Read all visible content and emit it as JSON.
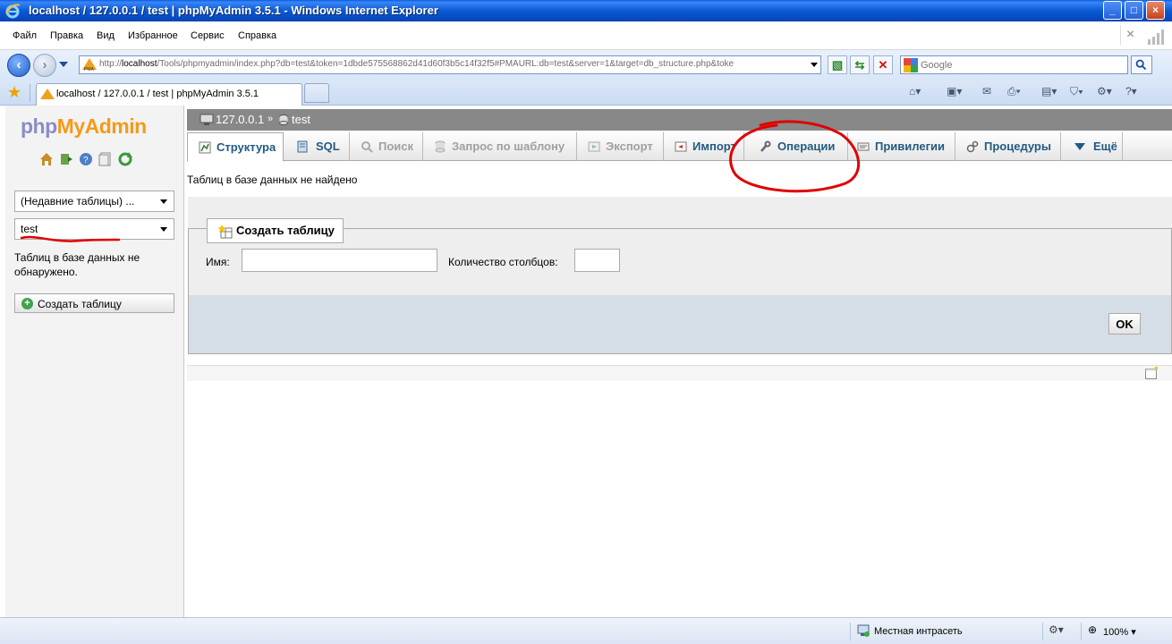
{
  "window": {
    "title": "localhost / 127.0.0.1 / test | phpMyAdmin 3.5.1 - Windows Internet Explorer",
    "controls": [
      "_",
      "□",
      "×"
    ]
  },
  "menubar": {
    "items": [
      "Файл",
      "Правка",
      "Вид",
      "Избранное",
      "Сервис",
      "Справка"
    ]
  },
  "address": {
    "prefix": "http://",
    "host": "localhost",
    "rest": "/Tools/phpmyadmin/index.php?db=test&token=1dbde575568862d41d60f3b5c14f32f5#PMAURL:db=test&server=1&target=db_structure.php&toke",
    "search_placeholder": "Google"
  },
  "browser_tab": {
    "label": "localhost / 127.0.0.1 / test | phpMyAdmin 3.5.1"
  },
  "left_panel": {
    "logo_php": "php",
    "logo_myadmin": "MyAdmin",
    "recent_tables": "(Недавние таблицы) ...",
    "db_select": "test",
    "no_tables": "Таблиц в базе данных не обнаружено.",
    "create_table": "Создать таблицу"
  },
  "breadcrumb": {
    "server": "127.0.0.1",
    "separator": "»",
    "database": "test"
  },
  "tabs": [
    {
      "label": "Структура",
      "state": "active"
    },
    {
      "label": "SQL",
      "state": "enabled"
    },
    {
      "label": "Поиск",
      "state": "disabled"
    },
    {
      "label": "Запрос по шаблону",
      "state": "disabled"
    },
    {
      "label": "Экспорт",
      "state": "disabled"
    },
    {
      "label": "Импорт",
      "state": "enabled"
    },
    {
      "label": "Операции",
      "state": "enabled"
    },
    {
      "label": "Привилегии",
      "state": "enabled"
    },
    {
      "label": "Процедуры",
      "state": "enabled"
    },
    {
      "label": "Ещё",
      "state": "enabled"
    }
  ],
  "main": {
    "no_tables_msg": "Таблиц в базе данных не найдено",
    "create_legend": "Создать таблицу",
    "name_label": "Имя:",
    "name_value": "",
    "columns_label": "Количество столбцов:",
    "columns_value": "",
    "ok": "OK"
  },
  "statusbar": {
    "zone": "Местная интрасеть",
    "zoom": "100%"
  },
  "colors": {
    "title_bar": "#0b5ad6",
    "tab_text": "#235a81",
    "annotation": "#e00000",
    "logo_php": "#8c8cc7",
    "logo_myadmin": "#f39a1c"
  }
}
